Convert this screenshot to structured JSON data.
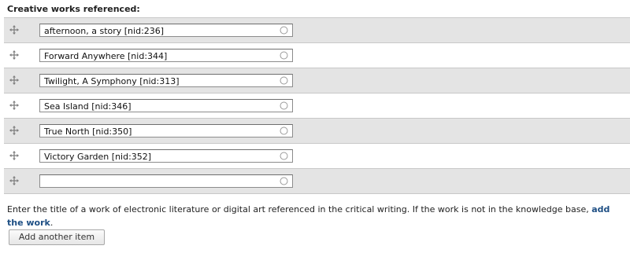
{
  "field": {
    "label": "Creative works referenced:",
    "items": [
      {
        "value": "afternoon, a story [nid:236]"
      },
      {
        "value": "Forward Anywhere [nid:344]"
      },
      {
        "value": "Twilight, A Symphony [nid:313]"
      },
      {
        "value": "Sea Island [nid:346]"
      },
      {
        "value": "True North [nid:350]"
      },
      {
        "value": "Victory Garden [nid:352]"
      },
      {
        "value": ""
      }
    ],
    "description_text": "Enter the title of a work of electronic literature or digital art referenced in the critical writing. If the work is not in the knowledge base, ",
    "description_link": "add the work",
    "description_end": ".",
    "add_button_label": "Add another item"
  },
  "icons": {
    "drag_handle": "drag-handle-icon",
    "autocomplete": "autocomplete-throbber-icon"
  },
  "colors": {
    "row_odd": "#e4e4e4",
    "row_even": "#ffffff",
    "link": "#1e4f84"
  }
}
